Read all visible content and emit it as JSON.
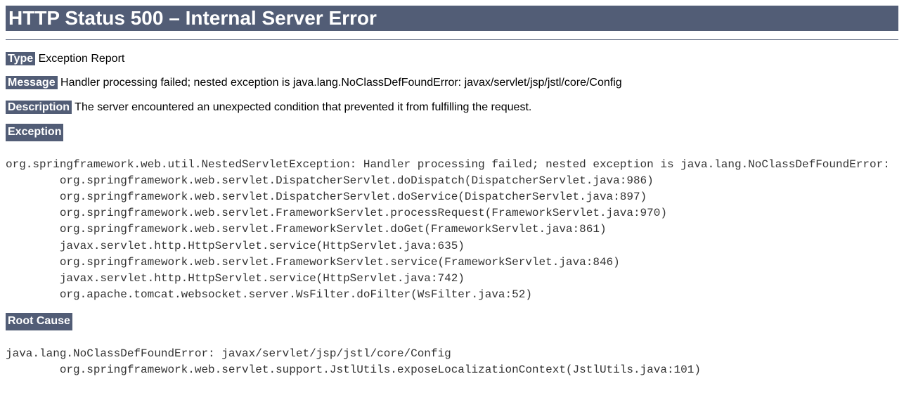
{
  "title": "HTTP Status 500 – Internal Server Error",
  "type": {
    "label": "Type",
    "value": "Exception Report"
  },
  "message": {
    "label": "Message",
    "value": "Handler processing failed; nested exception is java.lang.NoClassDefFoundError: javax/servlet/jsp/jstl/core/Config"
  },
  "description": {
    "label": "Description",
    "value": "The server encountered an unexpected condition that prevented it from fulfilling the request."
  },
  "exception": {
    "label": "Exception",
    "trace": "org.springframework.web.util.NestedServletException: Handler processing failed; nested exception is java.lang.NoClassDefFoundError:\n\torg.springframework.web.servlet.DispatcherServlet.doDispatch(DispatcherServlet.java:986)\n\torg.springframework.web.servlet.DispatcherServlet.doService(DispatcherServlet.java:897)\n\torg.springframework.web.servlet.FrameworkServlet.processRequest(FrameworkServlet.java:970)\n\torg.springframework.web.servlet.FrameworkServlet.doGet(FrameworkServlet.java:861)\n\tjavax.servlet.http.HttpServlet.service(HttpServlet.java:635)\n\torg.springframework.web.servlet.FrameworkServlet.service(FrameworkServlet.java:846)\n\tjavax.servlet.http.HttpServlet.service(HttpServlet.java:742)\n\torg.apache.tomcat.websocket.server.WsFilter.doFilter(WsFilter.java:52)"
  },
  "rootCause": {
    "label": "Root Cause",
    "trace": "java.lang.NoClassDefFoundError: javax/servlet/jsp/jstl/core/Config\n\torg.springframework.web.servlet.support.JstlUtils.exposeLocalizationContext(JstlUtils.java:101)"
  }
}
